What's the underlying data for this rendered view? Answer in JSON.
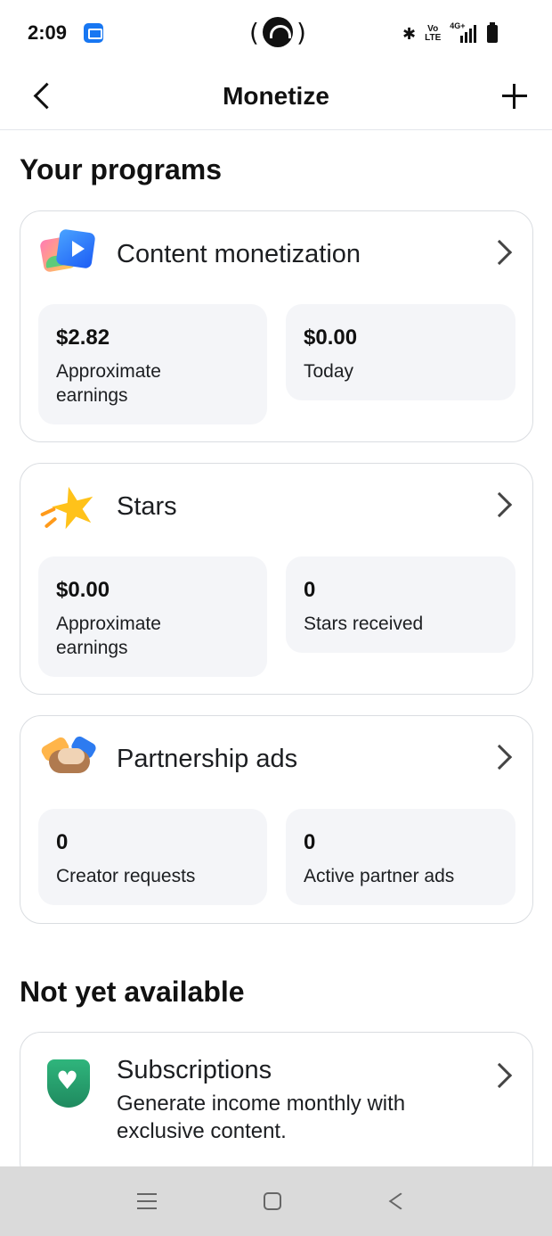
{
  "status_bar": {
    "time": "2:09",
    "cast_open": "(",
    "cast_close": ")",
    "bluetooth": "✱",
    "volte_top": "Vo",
    "volte_bottom": "LTE",
    "network": "4G+"
  },
  "header": {
    "title": "Monetize"
  },
  "sections": {
    "programs_title": "Your programs",
    "not_available_title": "Not yet available"
  },
  "programs": [
    {
      "title": "Content monetization",
      "stats": [
        {
          "value": "$2.82",
          "label": "Approximate earnings"
        },
        {
          "value": "$0.00",
          "label": "Today"
        }
      ]
    },
    {
      "title": "Stars",
      "stats": [
        {
          "value": "$0.00",
          "label": "Approximate earnings"
        },
        {
          "value": "0",
          "label": "Stars received"
        }
      ]
    },
    {
      "title": "Partnership ads",
      "stats": [
        {
          "value": "0",
          "label": "Creator requests"
        },
        {
          "value": "0",
          "label": "Active partner ads"
        }
      ]
    }
  ],
  "unavailable": [
    {
      "title": "Subscriptions",
      "description": "Generate income monthly with exclusive content."
    }
  ],
  "icons": {
    "star": "★",
    "heart": "♥"
  }
}
